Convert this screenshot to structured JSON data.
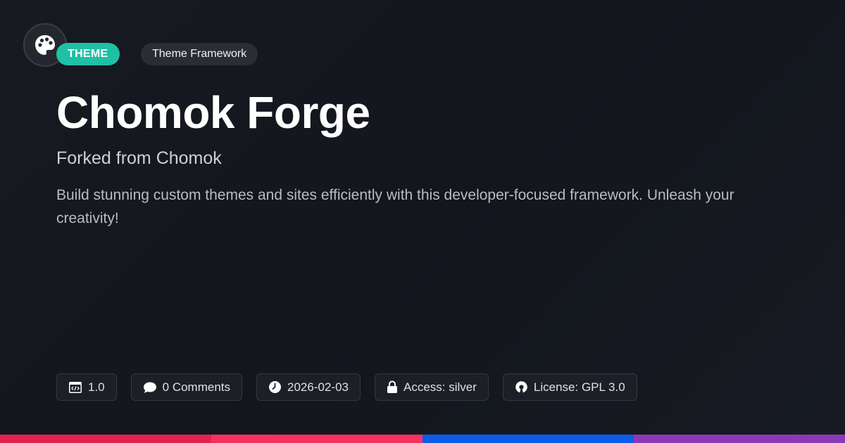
{
  "header": {
    "type_badge": "THEME",
    "category_badge": "Theme Framework"
  },
  "main": {
    "title": "Chomok Forge",
    "subtitle": "Forked from Chomok",
    "description": "Build stunning custom themes and sites efficiently with this developer-focused framework. Unleash your creativity!"
  },
  "meta": {
    "version": "1.0",
    "comments": "0 Comments",
    "date": "2026-02-03",
    "access": "Access: silver",
    "license": "License: GPL 3.0"
  },
  "icons": {
    "logo": "palette-icon",
    "version": "code-window-icon",
    "comments": "speech-bubble-icon",
    "date": "clock-icon",
    "access": "lock-icon",
    "license": "open-source-icon"
  },
  "colors": {
    "background": "#15181f",
    "type_badge": "#1fc0a5",
    "stripe": [
      "#e0244f",
      "#f43361",
      "#0a5ce5",
      "#8a3ab5"
    ]
  }
}
